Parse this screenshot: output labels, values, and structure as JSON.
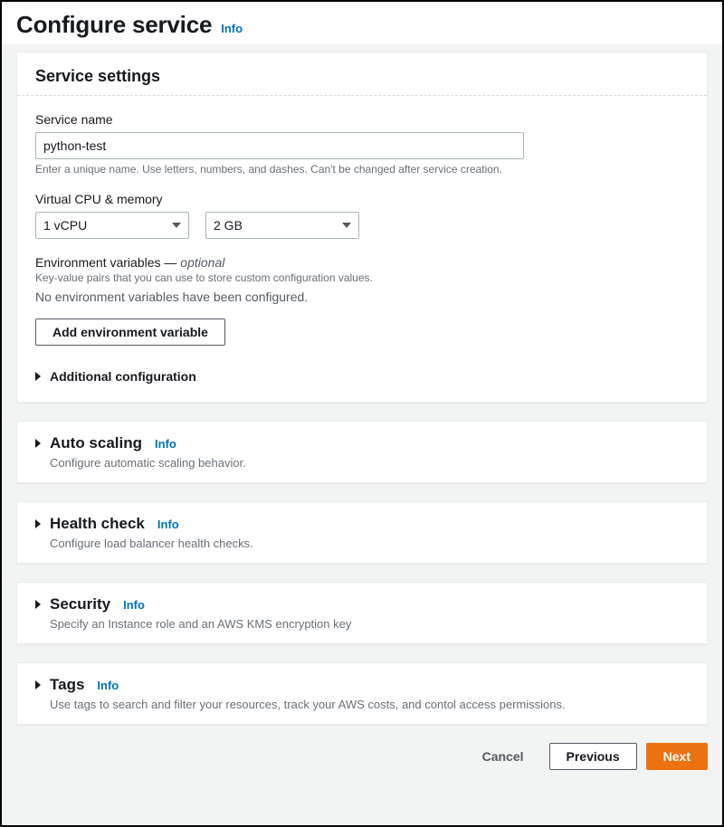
{
  "header": {
    "title": "Configure service",
    "info": "Info"
  },
  "service_settings": {
    "title": "Service settings",
    "name_label": "Service name",
    "name_value": "python-test",
    "name_hint": "Enter a unique name. Use letters, numbers, and dashes. Can't be changed after service creation.",
    "cpu_mem_label": "Virtual CPU & memory",
    "vcpu_value": "1 vCPU",
    "memory_value": "2 GB",
    "env_label": "Environment variables — ",
    "env_optional": "optional",
    "env_hint": "Key-value pairs that you can use to store custom configuration values.",
    "env_none": "No environment variables have been configured.",
    "add_env_button": "Add environment variable",
    "additional_config": "Additional configuration"
  },
  "sections": {
    "auto_scaling": {
      "title": "Auto scaling",
      "desc": "Configure automatic scaling behavior."
    },
    "health_check": {
      "title": "Health check",
      "desc": "Configure load balancer health checks."
    },
    "security": {
      "title": "Security",
      "desc": "Specify an Instance role and an AWS KMS encryption key"
    },
    "tags": {
      "title": "Tags",
      "desc": "Use tags to search and filter your resources, track your AWS costs, and contol access permissions."
    }
  },
  "info_link": "Info",
  "footer": {
    "cancel": "Cancel",
    "previous": "Previous",
    "next": "Next"
  }
}
